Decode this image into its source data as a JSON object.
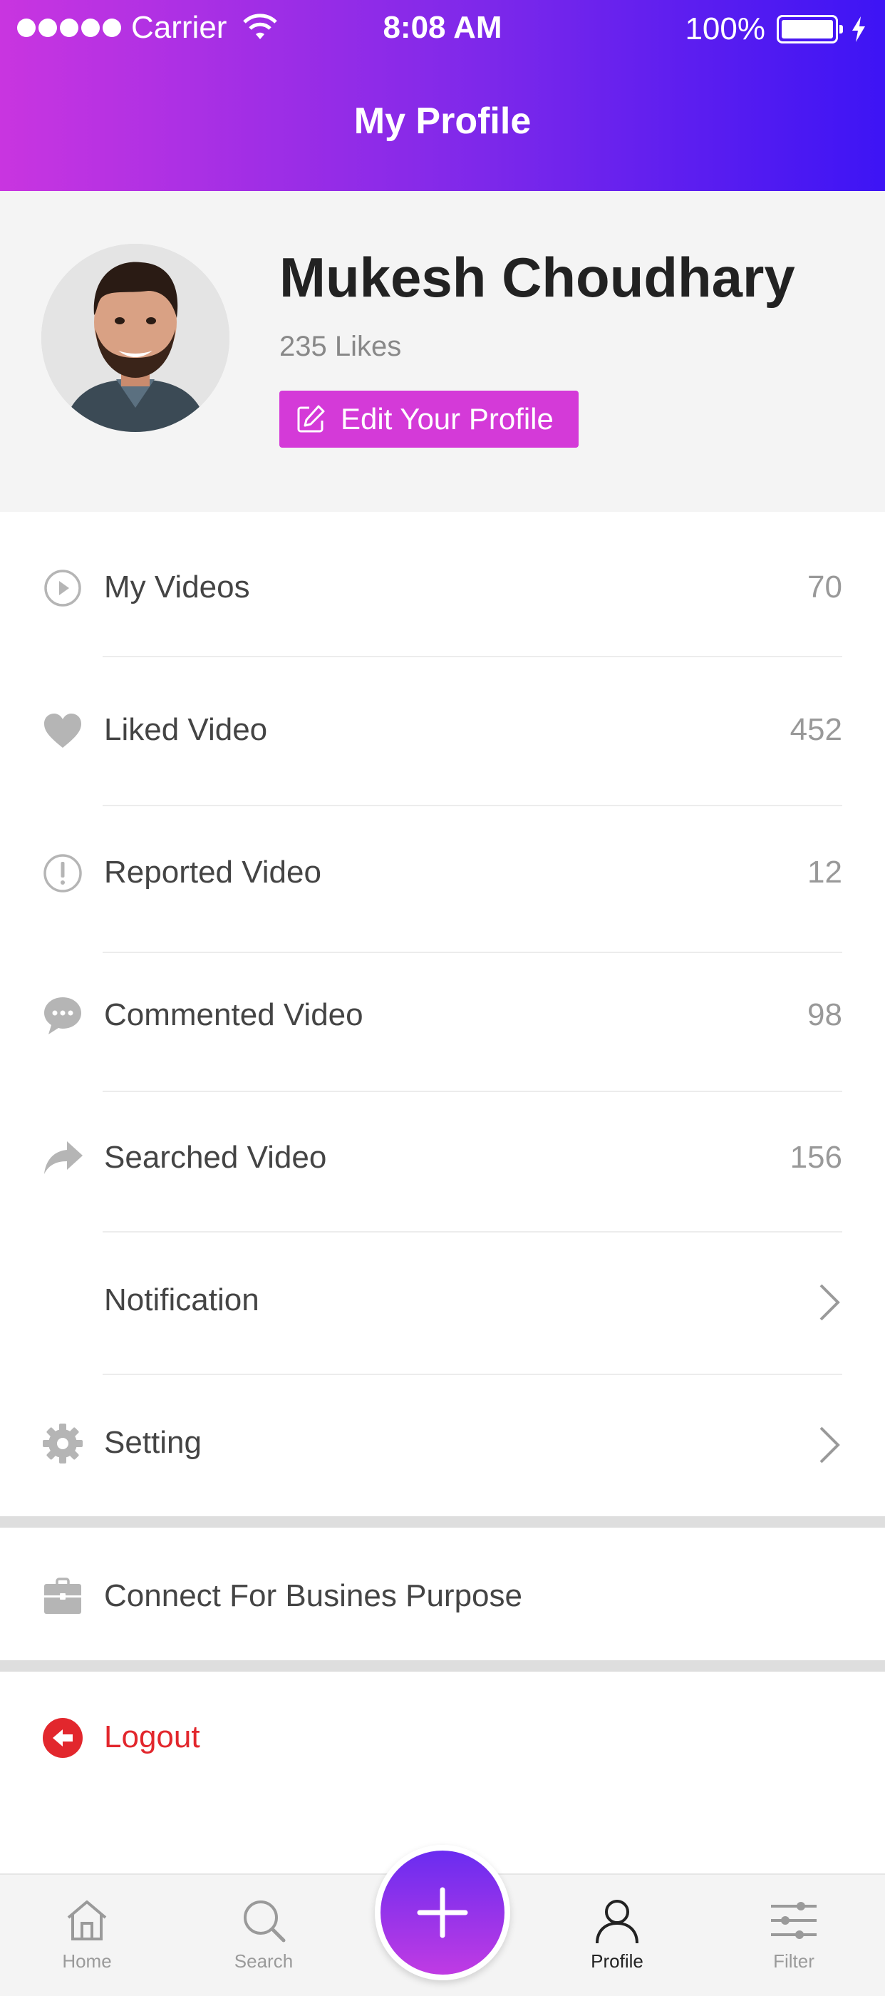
{
  "status_bar": {
    "carrier": "Carrier",
    "time": "8:08 AM",
    "battery": "100%"
  },
  "header": {
    "title": "My Profile"
  },
  "profile": {
    "name": "Mukesh Choudhary",
    "likes": "235 Likes",
    "edit_label": "Edit Your Profile"
  },
  "menu": {
    "my_videos": {
      "label": "My Videos",
      "count": "70"
    },
    "liked": {
      "label": "Liked Video",
      "count": "452"
    },
    "reported": {
      "label": "Reported Video",
      "count": "12"
    },
    "commented": {
      "label": "Commented Video",
      "count": "98"
    },
    "searched": {
      "label": "Searched Video",
      "count": "156"
    },
    "notification": {
      "label": "Notification"
    },
    "setting": {
      "label": "Setting"
    },
    "business": {
      "label": "Connect For Busines Purpose"
    },
    "logout": {
      "label": "Logout"
    }
  },
  "tabs": {
    "home": "Home",
    "search": "Search",
    "profile": "Profile",
    "filter": "Filter"
  },
  "colors": {
    "accent": "#d43ad8",
    "gradient_start": "#c935e0",
    "gradient_end": "#3d14f5",
    "logout": "#e2272d",
    "icon_gray": "#b5b5b5"
  },
  "icons": [
    "wifi-icon",
    "battery-icon",
    "edit-icon",
    "play-circle-icon",
    "heart-icon",
    "alert-circle-icon",
    "chat-bubble-icon",
    "share-arrow-icon",
    "gear-icon",
    "briefcase-icon",
    "logout-icon",
    "chevron-right-icon",
    "home-icon",
    "search-icon",
    "plus-icon",
    "user-icon",
    "sliders-icon"
  ]
}
